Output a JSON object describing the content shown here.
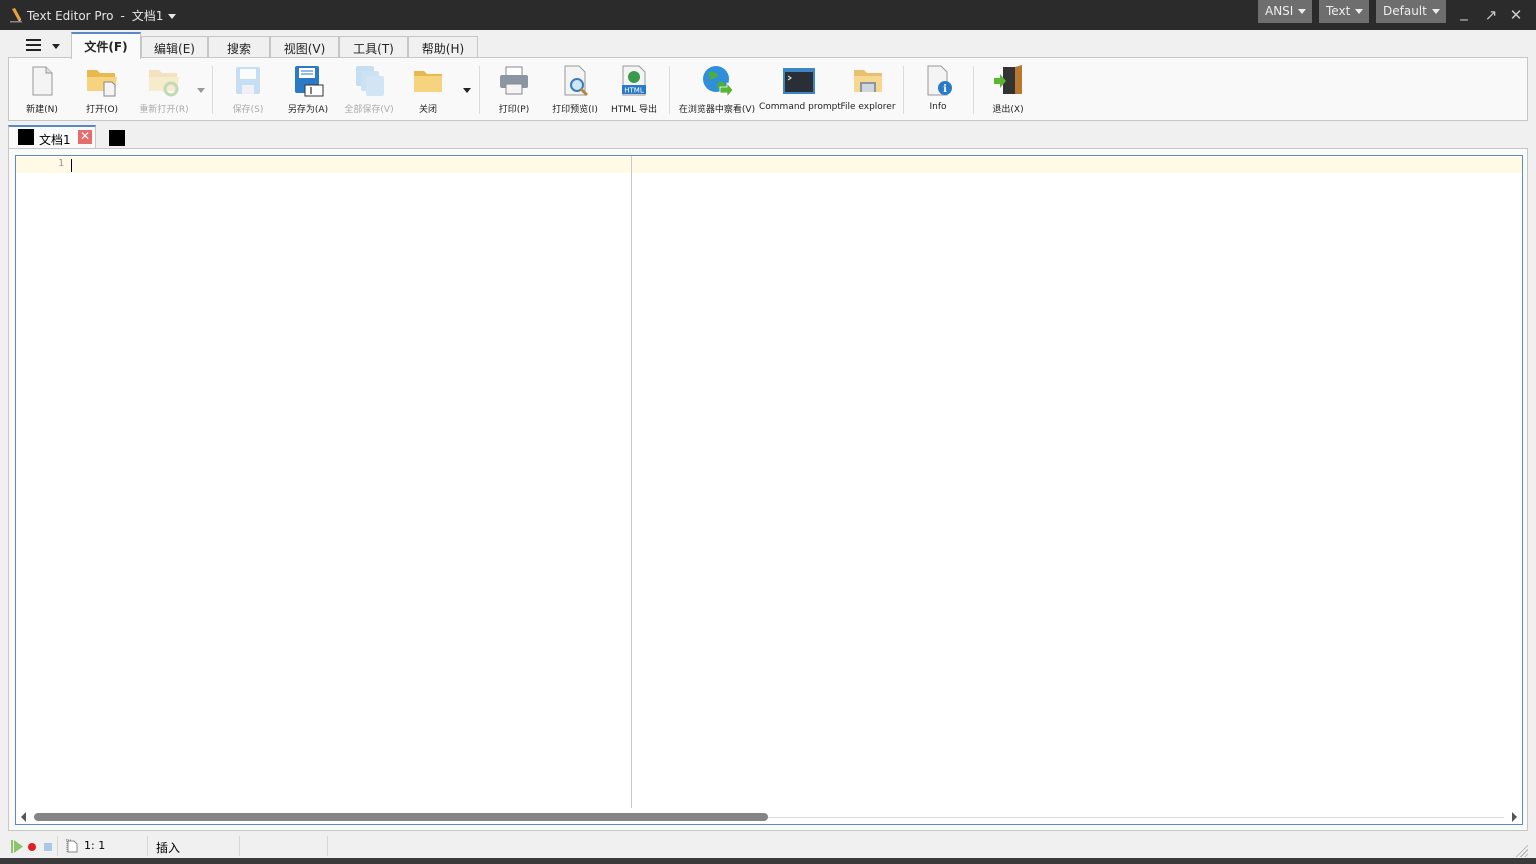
{
  "titlebar": {
    "app_name": "Text Editor Pro",
    "separator": "-",
    "document": "文档1",
    "encoding_dropdown": "ANSI",
    "syntax_dropdown": "Text",
    "theme_dropdown": "Default",
    "minimize": "_",
    "maximize": "↗",
    "close": "✕"
  },
  "menu": {
    "tabs": [
      {
        "label": "文件(F)",
        "active": true
      },
      {
        "label": "编辑(E)",
        "active": false
      },
      {
        "label": "搜索",
        "active": false
      },
      {
        "label": "视图(V)",
        "active": false
      },
      {
        "label": "工具(T)",
        "active": false
      },
      {
        "label": "帮助(H)",
        "active": false
      }
    ]
  },
  "ribbon": {
    "buttons": [
      {
        "label": "新建(N)",
        "icon": "new-file-icon",
        "enabled": true
      },
      {
        "label": "打开(O)",
        "icon": "open-folder-icon",
        "enabled": true
      },
      {
        "label": "重新打开(R)",
        "icon": "reopen-icon",
        "enabled": false
      },
      {
        "label": "保存(S)",
        "icon": "save-icon",
        "enabled": false
      },
      {
        "label": "另存为(A)",
        "icon": "save-as-icon",
        "enabled": true
      },
      {
        "label": "全部保存(V)",
        "icon": "save-all-icon",
        "enabled": false
      },
      {
        "label": "关闭",
        "icon": "close-folder-icon",
        "enabled": true
      },
      {
        "label": "打印(P)",
        "icon": "printer-icon",
        "enabled": true
      },
      {
        "label": "打印预览(I)",
        "icon": "print-preview-icon",
        "enabled": true
      },
      {
        "label": "HTML 导出",
        "icon": "html-export-icon",
        "enabled": true
      },
      {
        "label": "在浏览器中察看(V)",
        "icon": "globe-icon",
        "enabled": true
      },
      {
        "label": "Command prompt",
        "icon": "terminal-icon",
        "enabled": true
      },
      {
        "label": "File explorer",
        "icon": "file-explorer-icon",
        "enabled": true
      },
      {
        "label": "Info",
        "icon": "info-icon",
        "enabled": true
      },
      {
        "label": "退出(X)",
        "icon": "exit-door-icon",
        "enabled": true
      }
    ]
  },
  "doc_tabs": [
    {
      "label": "文档1",
      "active": true
    }
  ],
  "editor": {
    "line_numbers": [
      "1"
    ],
    "content": ""
  },
  "statusbar": {
    "position": "1: 1",
    "mode": "插入"
  },
  "colors": {
    "titlebar_bg": "#2b2b2b",
    "accent": "#5b87c5",
    "current_line": "#fff9e6",
    "tab_close": "#e66d6d"
  }
}
